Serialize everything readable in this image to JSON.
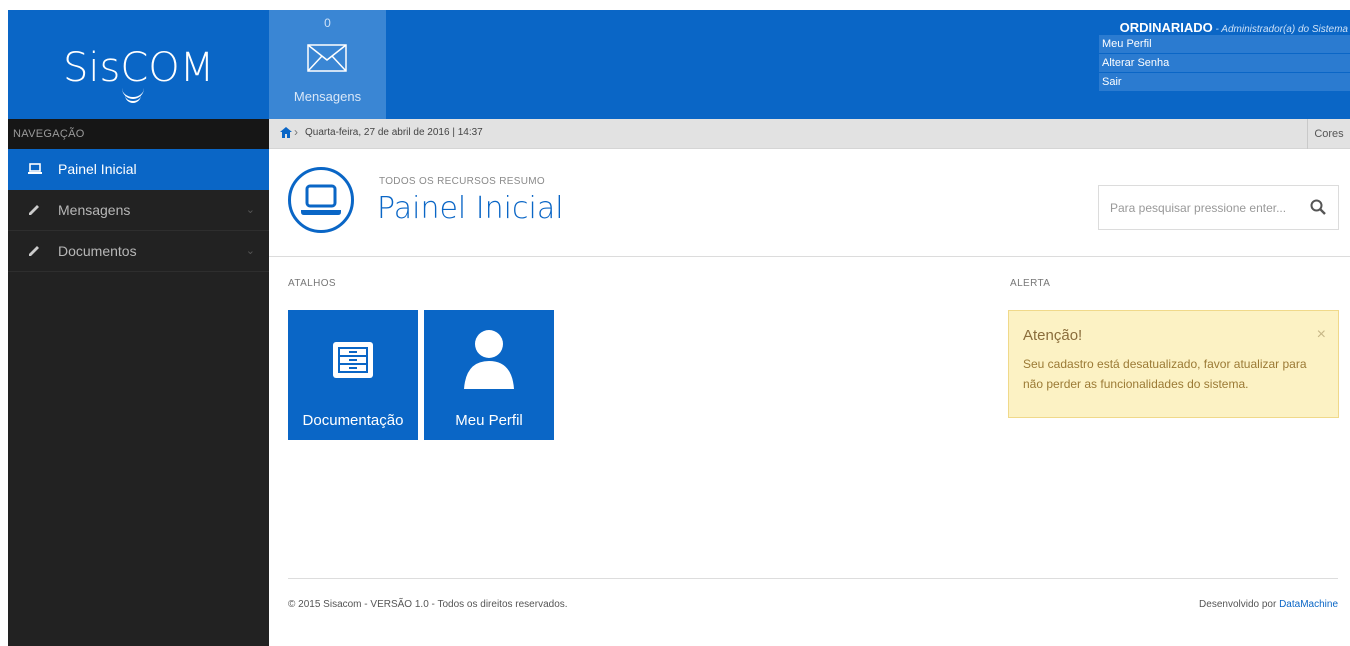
{
  "header": {
    "logo_text_start": "Sis",
    "logo_text_c": "C",
    "logo_text_end": "OM",
    "messages_count": "0",
    "messages_label": "Mensagens",
    "user_name": "ORDINARIADO",
    "user_role": " - Administrador(a) do Sistema",
    "user_menu": [
      "Meu Perfil",
      "Alterar Senha",
      "Sair"
    ]
  },
  "sidebar": {
    "title": "NAVEGAÇÃO",
    "items": [
      {
        "label": "Painel Inicial",
        "icon": "laptop-icon",
        "active": true
      },
      {
        "label": "Mensagens",
        "icon": "pencil-icon"
      },
      {
        "label": "Documentos",
        "icon": "pencil-icon"
      }
    ]
  },
  "breadcrumb": {
    "text": "Quarta-feira, 27 de abril de 2016 | 14:37",
    "cores_label": "Cores"
  },
  "page": {
    "subtitle": "TODOS OS RECURSOS RESUMO",
    "title": "Painel Inicial",
    "search_placeholder": "Para pesquisar pressione enter..."
  },
  "shortcuts": {
    "label": "ATALHOS",
    "tiles": [
      {
        "label": "Documentação",
        "icon": "file-cabinet-icon"
      },
      {
        "label": "Meu Perfil",
        "icon": "user-icon"
      }
    ]
  },
  "alert": {
    "label": "ALERTA",
    "title": "Atenção!",
    "text": "Seu cadastro está desatualizado, favor atualizar para não perder as funcionalidades do sistema.",
    "close": "×"
  },
  "footer": {
    "left": "© 2015 Sisacom - VERSÃO 1.0 - Todos os direitos reservados.",
    "right_prefix": "Desenvolvido por ",
    "right_link": "DataMachine"
  },
  "colors": {
    "primary": "#0a66c6",
    "sidebar_bg": "#222222",
    "alert_bg": "#fcf2c4"
  }
}
